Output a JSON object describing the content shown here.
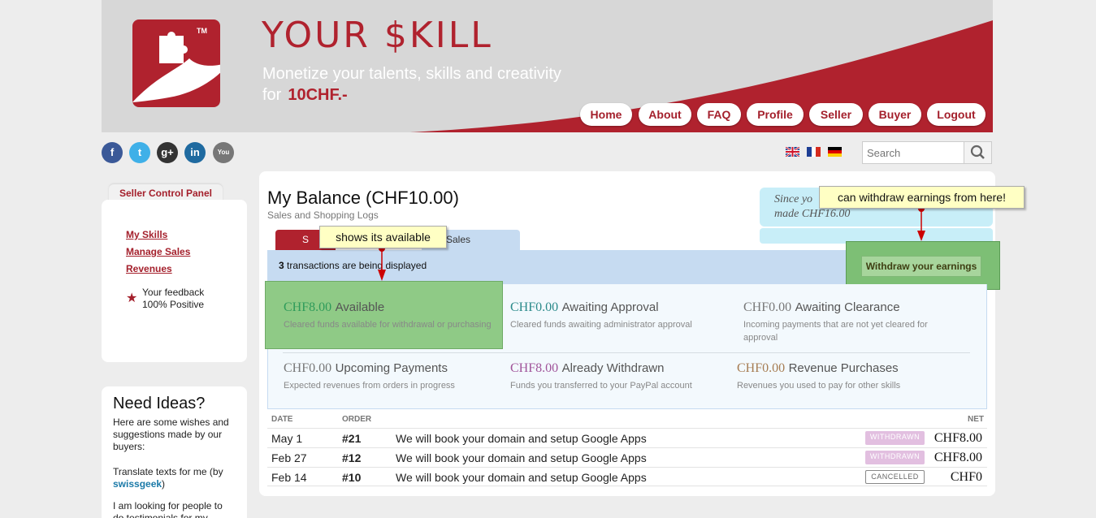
{
  "header": {
    "brand": "YOUR $KILL",
    "trademark": "TM",
    "tagline_line1": "Monetize your talents, skills and creativity",
    "tagline_line2_prefix": "for",
    "tagline_price": "10CHF.-",
    "nav": [
      "Home",
      "About",
      "FAQ",
      "Profile",
      "Seller",
      "Buyer",
      "Logout"
    ]
  },
  "social": [
    "facebook-icon",
    "twitter-icon",
    "google-plus-icon",
    "linkedin-icon",
    "youtube-icon"
  ],
  "flags": [
    "flag-uk-icon",
    "flag-france-icon",
    "flag-germany-icon"
  ],
  "search": {
    "placeholder": "Search"
  },
  "sidebar": {
    "panel_title": "Seller Control Panel",
    "links": [
      "My Skills",
      "Manage Sales",
      "Revenues"
    ],
    "feedback_line1": "Your feedback",
    "feedback_line2": "100% Positive",
    "ideas_title": "Need Ideas?",
    "ideas_intro": "Here are some wishes and suggestions made by our buyers:",
    "idea1_text": "Translate texts for me (by",
    "idea1_user": "swissgeek",
    "idea1_close": ")",
    "idea2_text": "I am looking for people to do testimonials for my"
  },
  "balance": {
    "title": "My Balance (CHF10.00)",
    "subtitle": "Sales and Shopping Logs",
    "since_line1": "Since yo",
    "since_line2": "made CHF16.00",
    "tab1": "S",
    "tab2": "Sales",
    "transactions_count": "3",
    "transactions_text": "transactions are being displayed",
    "withdraw_button": "Withdraw your earnings"
  },
  "summary": [
    {
      "amount": "CHF8.00",
      "label": "Available",
      "desc": "Cleared funds available for withdrawal or purchasing",
      "color": "#2e9b5a"
    },
    {
      "amount": "CHF0.00",
      "label": "Awaiting Approval",
      "desc": "Cleared funds awaiting administrator approval",
      "color": "#2a8a8a"
    },
    {
      "amount": "CHF0.00",
      "label": "Awaiting Clearance",
      "desc": "Incoming payments that are not yet cleared for approval",
      "color": "#777777"
    },
    {
      "amount": "CHF0.00",
      "label": "Upcoming Payments",
      "desc": "Expected revenues from orders in progress",
      "color": "#777777"
    },
    {
      "amount": "CHF8.00",
      "label": "Already Withdrawn",
      "desc": "Funds you transferred to your PayPal account",
      "color": "#a0549a"
    },
    {
      "amount": "CHF0.00",
      "label": "Revenue Purchases",
      "desc": "Revenues you used to pay for other skills",
      "color": "#a67c52"
    }
  ],
  "table": {
    "headers": {
      "date": "DATE",
      "order": "ORDER",
      "net": "NET"
    },
    "rows": [
      {
        "date": "May 1",
        "order": "#21",
        "title": "We will book your domain and setup Google Apps",
        "status": "WITHDRAWN",
        "net": "CHF8.00"
      },
      {
        "date": "Feb 27",
        "order": "#12",
        "title": "We will book your domain and setup Google Apps",
        "status": "WITHDRAWN",
        "net": "CHF8.00"
      },
      {
        "date": "Feb 14",
        "order": "#10",
        "title": "We will book your domain and setup Google Apps",
        "status": "CANCELLED",
        "net": "CHF0"
      }
    ]
  },
  "callouts": {
    "withdraw": "can withdraw earnings from here!",
    "available": "shows its available"
  }
}
